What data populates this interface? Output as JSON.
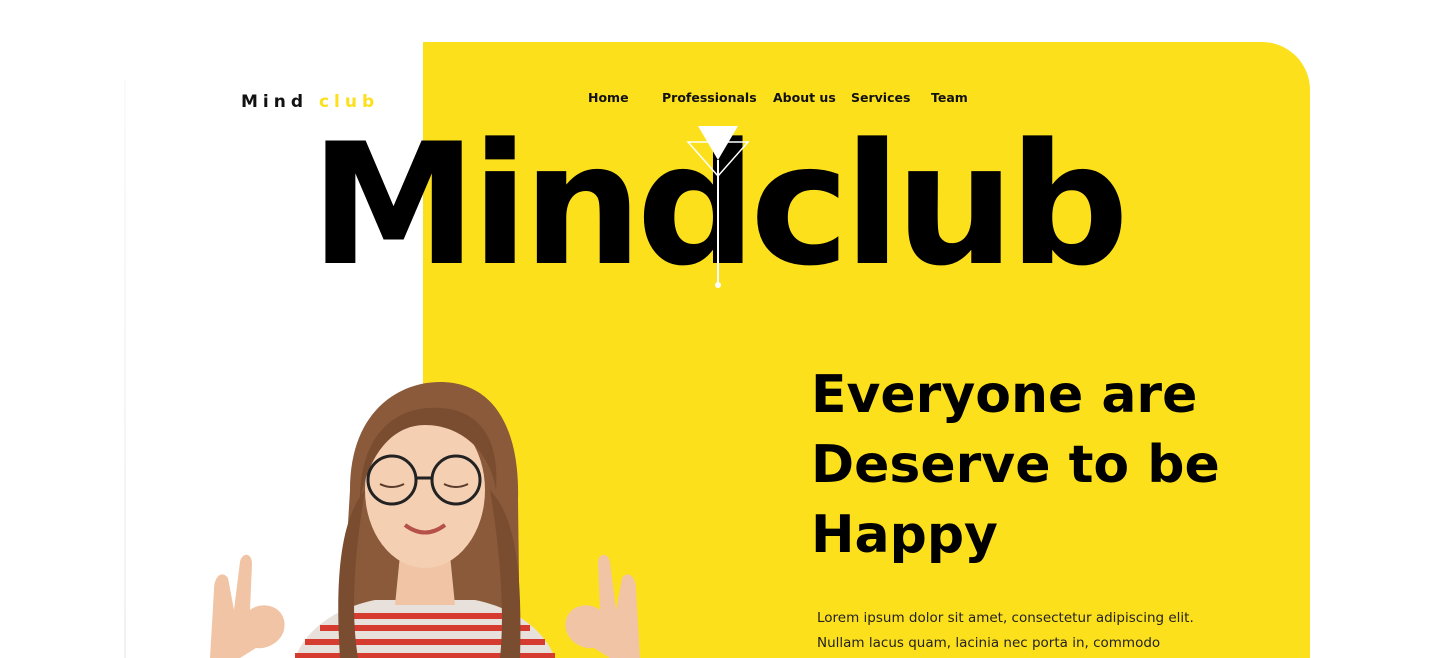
{
  "logo": {
    "word1": "Mind",
    "word2": "club"
  },
  "nav": {
    "items": [
      {
        "label": "Home"
      },
      {
        "label": "Professionals"
      },
      {
        "label": "About us"
      },
      {
        "label": "Services"
      },
      {
        "label": "Team"
      }
    ]
  },
  "hero": {
    "title_word1": "Mind",
    "title_word2": "club",
    "headline_lines": [
      "Everyone are",
      "Deserve to be",
      "Happy"
    ],
    "description": "Lorem ipsum dolor sit amet, consectetur adipiscing elit. Nullam lacus quam, lacinia nec porta in, commodo"
  },
  "icons": {
    "glass": "cocktail-glass-icon"
  },
  "colors": {
    "accent": "#fde01c",
    "text": "#000000",
    "background": "#ffffff"
  }
}
